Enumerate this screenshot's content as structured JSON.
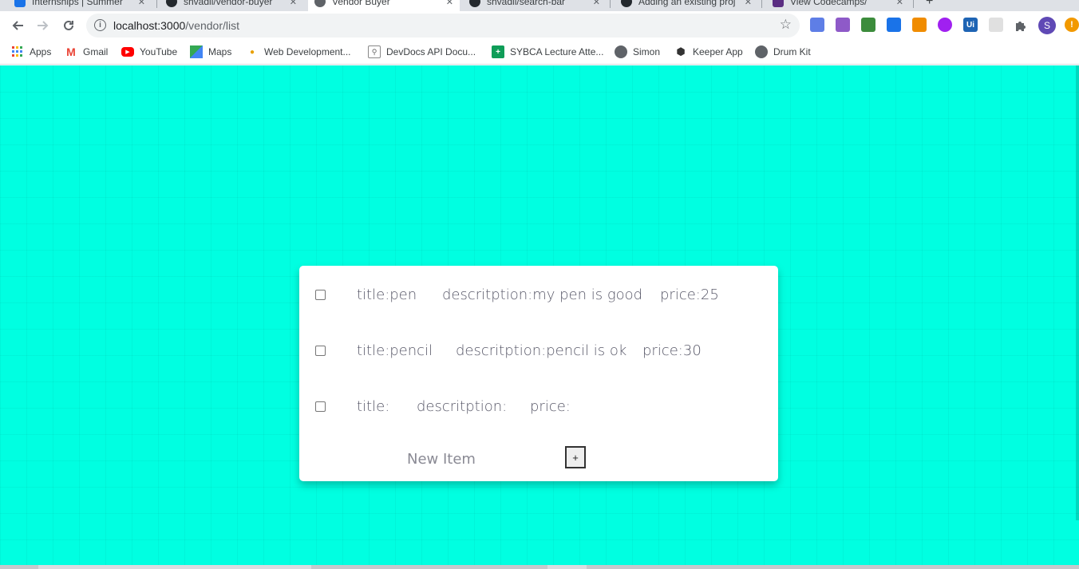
{
  "browser": {
    "tabs": [
      {
        "label": "Internships | Summer",
        "color": "#1a73e8"
      },
      {
        "label": "shvadil/vendor-buyer",
        "color": "#24292e"
      },
      {
        "label": "Vendor Buyer",
        "color": "#5f6368"
      },
      {
        "label": "shvadil/search-bar",
        "color": "#24292e"
      },
      {
        "label": "Adding an existing proj",
        "color": "#24292e"
      },
      {
        "label": "View Codecamps/",
        "color": "#5a2d82"
      }
    ],
    "url_host": "localhost:3000",
    "url_path": "/vendor/list",
    "icons": {
      "back": "arrow-left-icon",
      "forward": "arrow-right-icon",
      "reload": "reload-icon",
      "info": "info-icon",
      "star": "star-icon",
      "extensions": "puzzle-icon",
      "menu": "kebab-menu-icon"
    },
    "profile_initial": "S",
    "extensions": [
      {
        "label": "",
        "color": "#5e7ee6"
      },
      {
        "label": "",
        "color": "#8e5ac8"
      },
      {
        "label": "",
        "color": "#3c8c3c"
      },
      {
        "label": "",
        "color": "#1a73e8"
      },
      {
        "label": "",
        "color": "#f08c00"
      },
      {
        "label": "",
        "color": "#a020f0"
      },
      {
        "label": "Ui",
        "color": "#1e64b4"
      },
      {
        "label": "",
        "color": "#e0e0e0"
      }
    ],
    "bookmarks": [
      {
        "label": "Apps",
        "icon": "apps-grid-icon"
      },
      {
        "label": "Gmail",
        "icon": "gmail-icon"
      },
      {
        "label": "YouTube",
        "icon": "youtube-icon"
      },
      {
        "label": "Maps",
        "icon": "maps-icon"
      },
      {
        "label": "Web Development...",
        "icon": "bookmark-icon"
      },
      {
        "label": "DevDocs API Docu...",
        "icon": "devdocs-icon"
      },
      {
        "label": "SYBCA Lecture Atte...",
        "icon": "sheets-icon"
      },
      {
        "label": "Simon",
        "icon": "globe-icon"
      },
      {
        "label": "Keeper App",
        "icon": "codesandbox-icon"
      },
      {
        "label": "Drum Kit",
        "icon": "globe-icon"
      }
    ]
  },
  "list": {
    "items": [
      {
        "title": "title:pen",
        "description": "descritption:my pen is good",
        "price": "price:25"
      },
      {
        "title": "title:pencil",
        "description": "descritption:pencil is ok",
        "price": "price:30"
      },
      {
        "title": "title:",
        "description": "descritption:",
        "price": "price:"
      }
    ],
    "new_item_placeholder": "New Item",
    "add_button_label": "+"
  },
  "colors": {
    "page_background": "#00ffe1",
    "card_background": "#ffffff"
  }
}
